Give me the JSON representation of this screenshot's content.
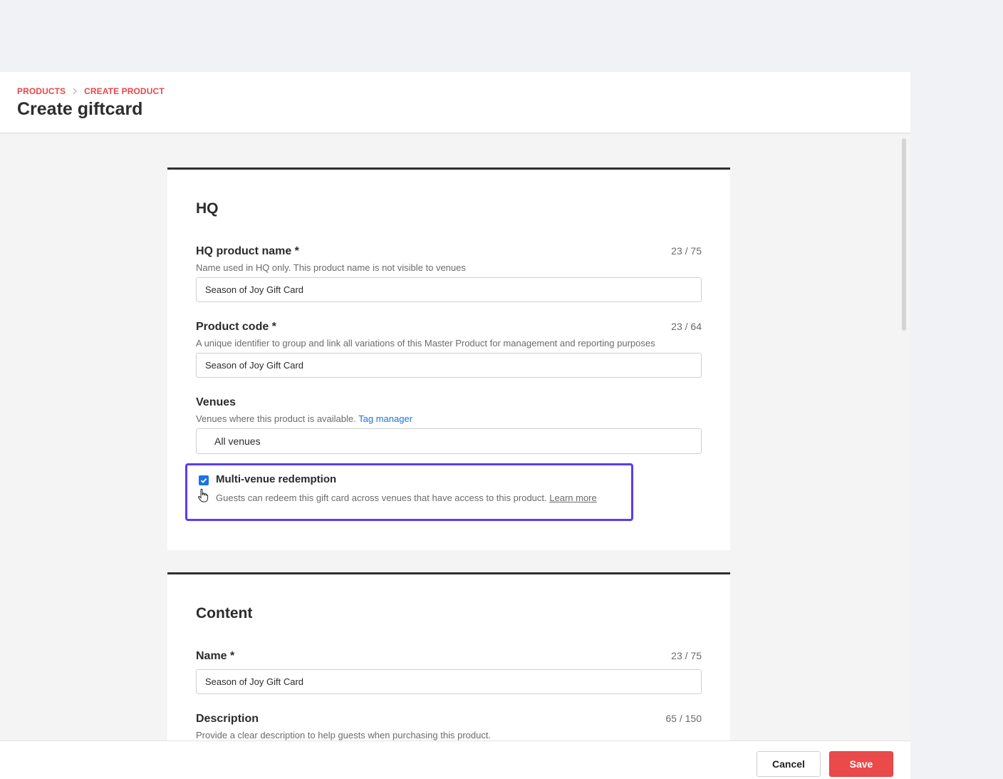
{
  "header": {
    "breadcrumb": [
      "PRODUCTS",
      "CREATE PRODUCT"
    ],
    "title": "Create giftcard"
  },
  "hq": {
    "section_title": "HQ",
    "product_name": {
      "label": "HQ product name *",
      "counter": "23 / 75",
      "help": "Name used in HQ only. This product name is not visible to venues",
      "value": "Season of Joy Gift Card"
    },
    "product_code": {
      "label": "Product code *",
      "counter": "23 / 64",
      "help": "A unique identifier to group and link all variations of this Master Product for management and reporting purposes",
      "value": "Season of Joy Gift Card"
    },
    "venues": {
      "label": "Venues",
      "help": "Venues where this product is available.",
      "help_link": "Tag manager",
      "value": "All venues"
    },
    "multi_venue": {
      "checked": true,
      "label": "Multi-venue redemption",
      "help": "Guests can redeem this gift card across venues that have access to this product.",
      "help_link": "Learn more"
    }
  },
  "content": {
    "section_title": "Content",
    "name": {
      "label": "Name *",
      "counter": "23 / 75",
      "value": "Season of Joy Gift Card"
    },
    "description": {
      "label": "Description",
      "counter": "65 / 150",
      "help": "Provide a clear description to help guests when purchasing this product."
    }
  },
  "footer": {
    "cancel_label": "Cancel",
    "save_label": "Save"
  },
  "colors": {
    "accent_red": "#e8474a",
    "highlight": "#5b3df0",
    "link_blue": "#1a73e8"
  }
}
